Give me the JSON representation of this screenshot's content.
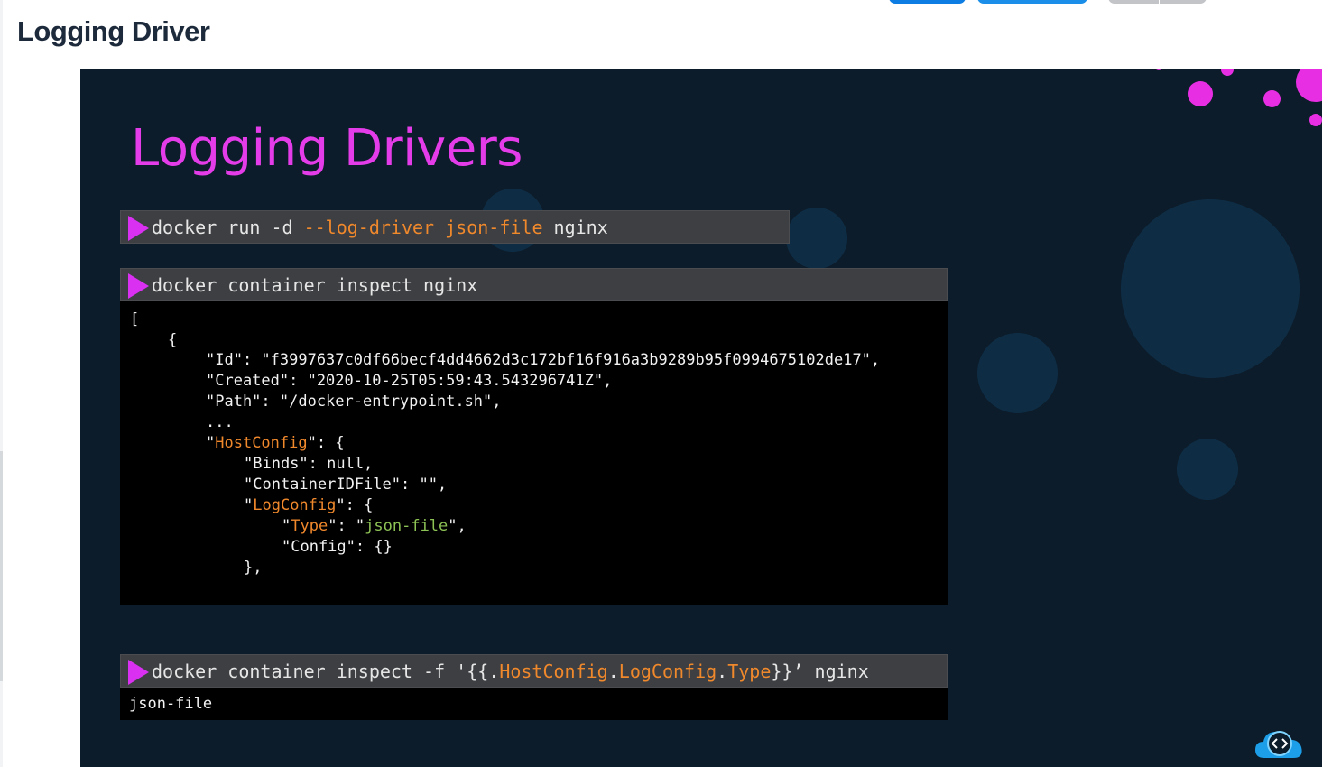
{
  "header": {
    "title": "Logging Driver"
  },
  "slide": {
    "title": "Logging Drivers",
    "cmd1": {
      "prefix": "docker run -d ",
      "flag": "--log-driver json-file",
      "suffix": " nginx"
    },
    "cmd2": {
      "text": "docker container inspect nginx"
    },
    "json_output": {
      "open_bracket": "[",
      "open_brace": "{",
      "id_line": "\"Id\": \"f3997637c0df66becf4dd4662d3c172bf16f916a3b9289b95f0994675102de17\",",
      "created_line": "\"Created\": \"2020-10-25T05:59:43.543296741Z\",",
      "path_line": "\"Path\": \"/docker-entrypoint.sh\",",
      "ellipsis": "...",
      "hostconfig_key": "HostConfig",
      "binds_line": "\"Binds\": null,",
      "containeridfile_line": "\"ContainerIDFile\": \"\",",
      "logconfig_key": "LogConfig",
      "type_key": "Type",
      "type_value": "json-file",
      "config_line": "\"Config\": {}",
      "close_line": "},"
    },
    "cmd3": {
      "prefix": "docker container inspect -f '{{.",
      "hostconfig": "HostConfig",
      "dot1": ".",
      "logconfig": "LogConfig",
      "dot2": ".",
      "type": "Type",
      "suffix": "}}’ nginx"
    },
    "cmd3_output": "json-file"
  },
  "colors": {
    "slide_bg": "#0c1c2a",
    "title": "#e43ce8",
    "accent_orange": "#f0882c",
    "accent_green": "#8dc255",
    "arrow": "#d930f2"
  },
  "icons": {
    "cmd_prompt": "play-triangle-icon",
    "brand": "cloud-code-icon"
  }
}
